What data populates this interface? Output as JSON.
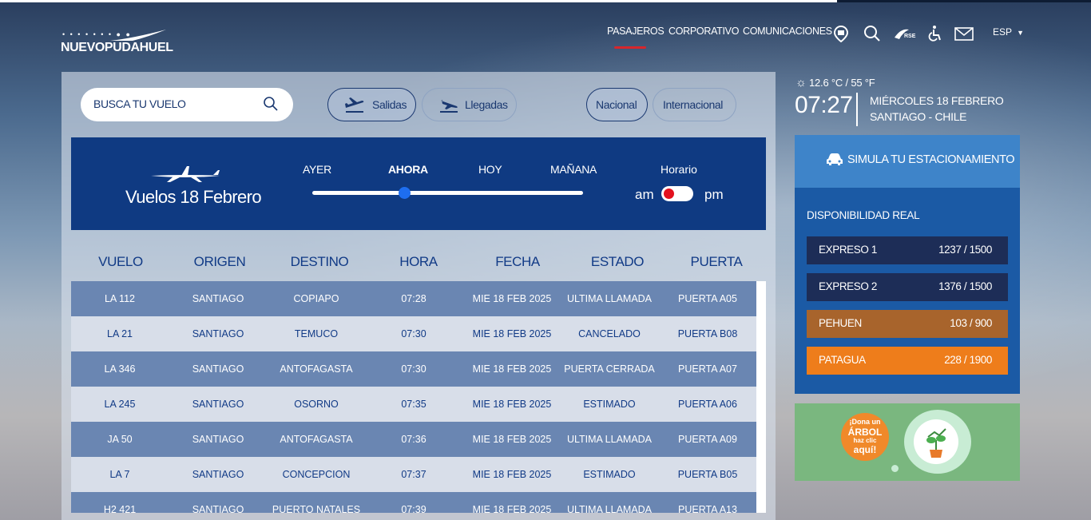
{
  "brand": {
    "logo_text": "NUEVOPUDAHUEL"
  },
  "nav": {
    "items": [
      "PASAJEROS",
      "CORPORATIVO",
      "COMUNICACIONES"
    ],
    "active": "PASAJEROS",
    "icons": [
      "location-icon",
      "search-icon",
      "rse-icon",
      "accessibility-icon",
      "mail-icon"
    ],
    "rse_label": "RSE",
    "language": "ESP"
  },
  "search": {
    "placeholder": "BUSCA TU VUELO"
  },
  "filters": {
    "departures": "Salidas",
    "arrivals": "Llegadas",
    "national": "Nacional",
    "international": "Internacional"
  },
  "banner": {
    "title": "Vuelos 18 Febrero",
    "timeline": [
      "AYER",
      "AHORA",
      "HOY",
      "MAÑANA"
    ],
    "timeline_active": "AHORA",
    "schedule_label": "Horario",
    "am": "am",
    "pm": "pm"
  },
  "table": {
    "headers": [
      "VUELO",
      "ORIGEN",
      "DESTINO",
      "HORA",
      "FECHA",
      "ESTADO",
      "PUERTA"
    ],
    "rows": [
      [
        "LA 112",
        "SANTIAGO",
        "COPIAPO",
        "07:28",
        "MIE 18 FEB 2025",
        "ULTIMA LLAMADA",
        "PUERTA A05"
      ],
      [
        "LA 21",
        "SANTIAGO",
        "TEMUCO",
        "07:30",
        "MIE 18 FEB 2025",
        "CANCELADO",
        "PUERTA B08"
      ],
      [
        "LA 346",
        "SANTIAGO",
        "ANTOFAGASTA",
        "07:30",
        "MIE 18 FEB 2025",
        "PUERTA CERRADA",
        "PUERTA A07"
      ],
      [
        "LA 245",
        "SANTIAGO",
        "OSORNO",
        "07:35",
        "MIE 18 FEB 2025",
        "ESTIMADO",
        "PUERTA A06"
      ],
      [
        "JA 50",
        "SANTIAGO",
        "ANTOFAGASTA",
        "07:36",
        "MIE 18 FEB 2025",
        "ULTIMA LLAMADA",
        "PUERTA A09"
      ],
      [
        "LA 7",
        "SANTIAGO",
        "CONCEPCION",
        "07:37",
        "MIE 18 FEB 2025",
        "ESTIMADO",
        "PUERTA B05"
      ],
      [
        "H2 421",
        "SANTIAGO",
        "PUERTO NATALES",
        "07:39",
        "MIE 18 FEB 2025",
        "ULTIMA LLAMADA",
        "PUERTA A13"
      ]
    ]
  },
  "weather": {
    "text": "12.6 °C / 55 °F"
  },
  "clock": {
    "time": "07:27",
    "date": "MIÉRCOLES 18 FEBRERO",
    "location": "SANTIAGO - CHILE"
  },
  "parking": {
    "title": "SIMULA TU ESTACIONAMIENTO",
    "availability_label": "DISPONIBILIDAD REAL",
    "lots": [
      {
        "name": "EXPRESO 1",
        "value": "1237 / 1500",
        "color": "#1d2d57"
      },
      {
        "name": "EXPRESO 2",
        "value": "1376 / 1500",
        "color": "#1d2d57"
      },
      {
        "name": "PEHUEN",
        "value": "103 / 900",
        "color": "#a8642c"
      },
      {
        "name": "PATAGUA",
        "value": "228 / 1900",
        "color": "#ee7d1b"
      }
    ]
  },
  "tree_promo": {
    "line1": "¡Dona un",
    "line2": "ÁRBOL",
    "line3": "haz clic",
    "line4": "aquí!"
  }
}
